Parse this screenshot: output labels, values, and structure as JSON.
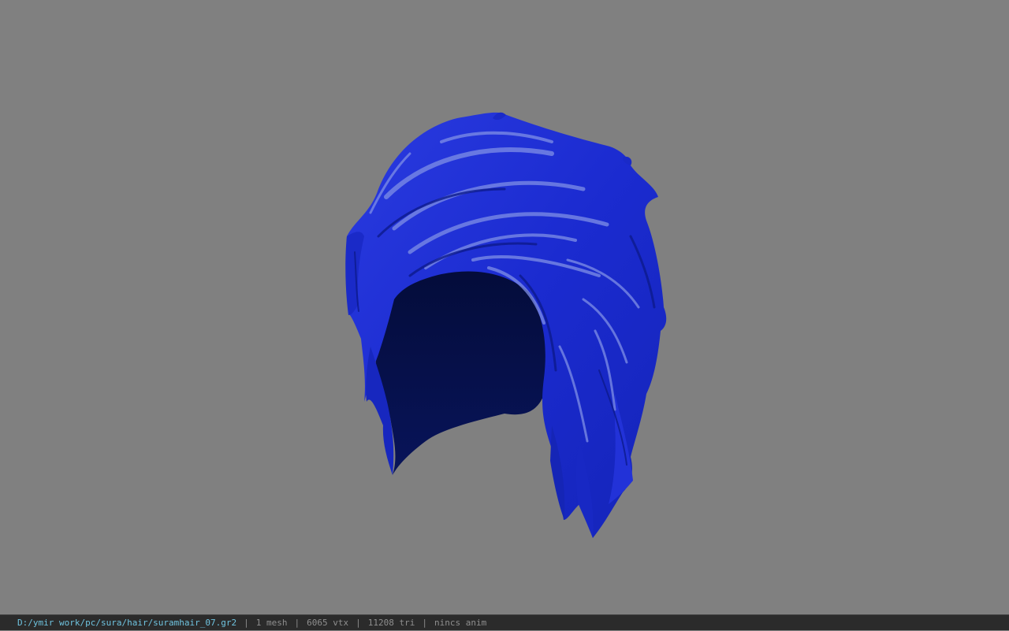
{
  "viewport": {
    "background_color": "#808080",
    "model": {
      "description_icon": "hair-mesh",
      "colors": {
        "base": "#1f2fd6",
        "dark": "#0a1a7a",
        "shadow": "#06104a",
        "highlight": "#7f8fe6"
      }
    }
  },
  "statusbar": {
    "file_path": "D:/ymir work/pc/sura/hair/suramhair_07.gr2",
    "separator": "|",
    "mesh_count": "1 mesh",
    "vertex_count": "6065 vtx",
    "triangle_count": "11208 tri",
    "anim_status": "nincs anim",
    "colors": {
      "path": "#6fc3df",
      "text": "#8f8f8f",
      "background": "#2b2b2b"
    }
  }
}
